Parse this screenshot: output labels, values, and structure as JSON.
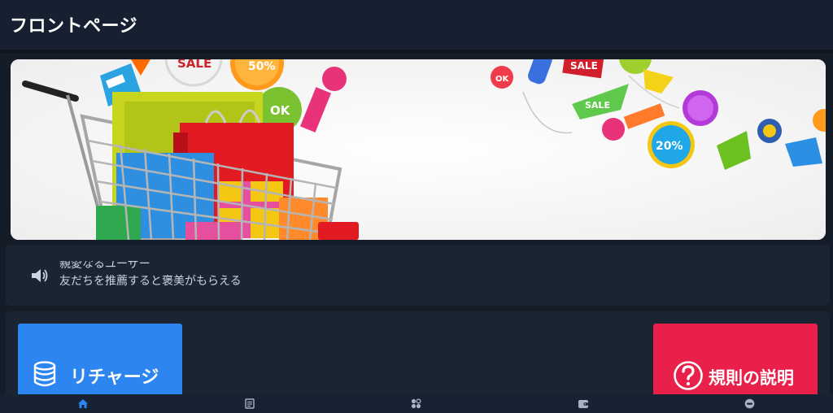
{
  "header": {
    "title": "フロントページ"
  },
  "banner": {
    "tags": [
      "SALE",
      "50%",
      "OK",
      "SALE",
      "SALE",
      "20%",
      "OK",
      "SALE"
    ]
  },
  "notice": {
    "icon": "speaker-icon",
    "lines": [
      "親愛なるユーザー",
      "友だちを推薦すると褒美がもらえる"
    ]
  },
  "actions": {
    "recharge": {
      "label": "リチャージ",
      "icon": "database-icon",
      "color": "#2d86ef"
    },
    "rules": {
      "label": "規則の説明",
      "icon": "question-circle-icon",
      "color": "#e8204a"
    }
  },
  "tabbar": {
    "active_color": "#2d86ef",
    "items": [
      {
        "icon": "home-icon",
        "active": true
      },
      {
        "icon": "list-icon",
        "active": false
      },
      {
        "icon": "apps-icon",
        "active": false
      },
      {
        "icon": "wallet-icon",
        "active": false
      },
      {
        "icon": "profile-icon",
        "active": false
      }
    ]
  }
}
